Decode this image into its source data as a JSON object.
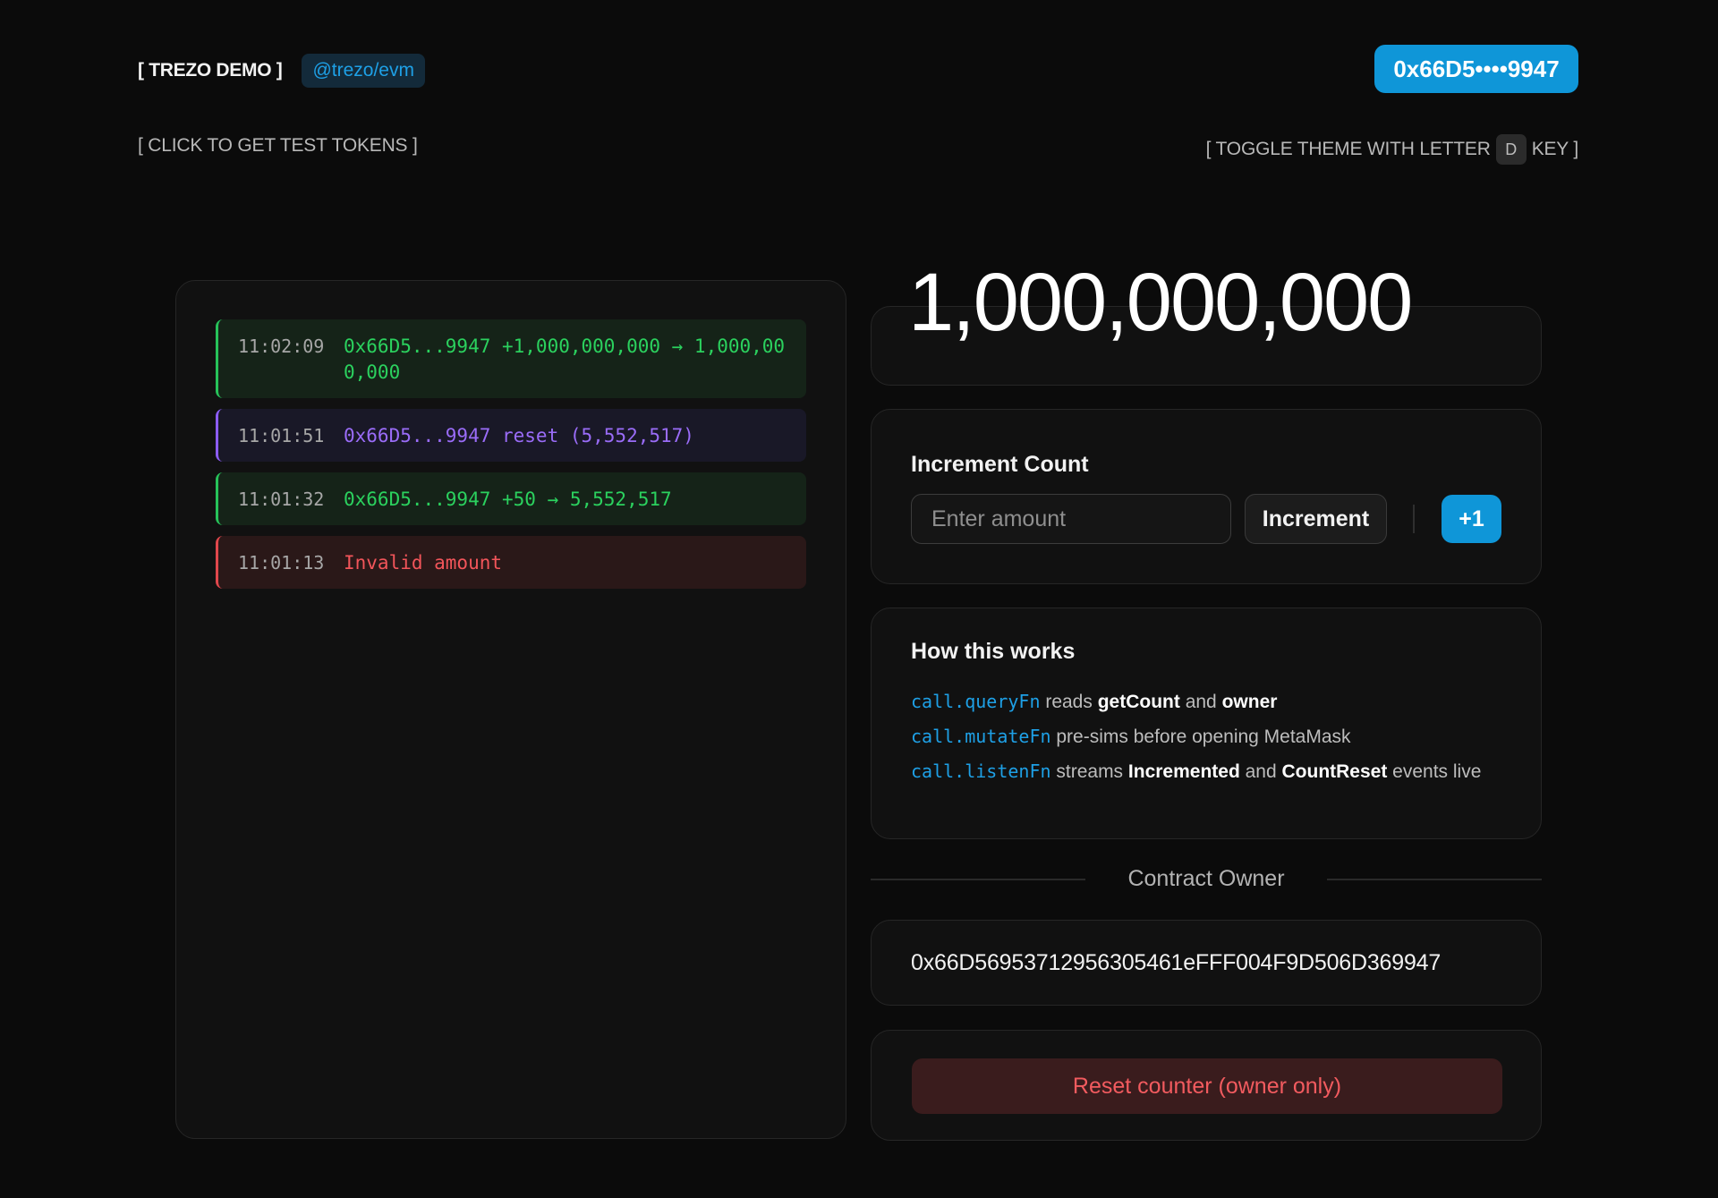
{
  "header": {
    "brand": "[ TREZO DEMO ]",
    "tag": "@trezo/evm",
    "wallet": "0x66D5••••9947",
    "faucet": "[ CLICK TO GET TEST TOKENS ]",
    "theme_before": "[ TOGGLE THEME WITH LETTER",
    "theme_key": "D",
    "theme_after": "KEY ]"
  },
  "log": [
    {
      "time": "11:02:09",
      "message": "0x66D5...9947 +1,000,000,000 → 1,000,000,000",
      "kind": "success"
    },
    {
      "time": "11:01:51",
      "message": "0x66D5...9947 reset (5,552,517)",
      "kind": "reset"
    },
    {
      "time": "11:01:32",
      "message": "0x66D5...9947 +50 → 5,552,517",
      "kind": "success"
    },
    {
      "time": "11:01:13",
      "message": "Invalid amount",
      "kind": "error"
    }
  ],
  "counter": {
    "value": "1,000,000,000"
  },
  "increment": {
    "title": "Increment Count",
    "placeholder": "Enter amount",
    "button": "Increment",
    "quick": "+1"
  },
  "how": {
    "title": "How this works",
    "line1": {
      "code": "call.queryFn",
      "t1": " reads ",
      "b1": "getCount",
      "t2": " and ",
      "b2": "owner"
    },
    "line2": {
      "code": "call.mutateFn",
      "t1": " pre-sims before opening MetaMask"
    },
    "line3": {
      "code": "call.listenFn",
      "t1": " streams ",
      "b1": "Incremented",
      "t2": " and ",
      "b2": "CountReset",
      "t3": " events live"
    }
  },
  "owner": {
    "label": "Contract Owner",
    "address": "0x66D56953712956305461eFFF004F9D506D369947"
  },
  "reset": {
    "button": "Reset counter (owner only)"
  },
  "colors": {
    "accent": "#0f96d8",
    "success": "#2bd15e",
    "reset": "#9a6cf8",
    "error": "#f2555a"
  }
}
